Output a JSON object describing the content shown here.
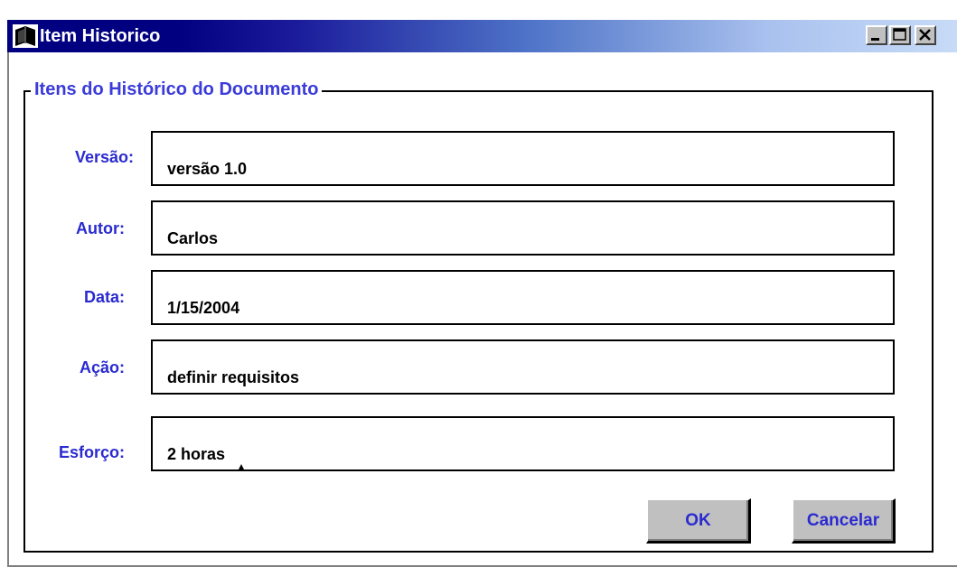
{
  "window": {
    "title": "Item Historico",
    "icon": "book-icon"
  },
  "titlebar_buttons": {
    "minimize": "minimize-icon",
    "maximize": "maximize-icon",
    "close": "close-icon"
  },
  "group": {
    "title": "Itens do Histórico do Documento"
  },
  "fields": [
    {
      "label": "Versão:",
      "value": "versão 1.0"
    },
    {
      "label": "Autor:",
      "value": "Carlos"
    },
    {
      "label": "Data:",
      "value": "1/15/2004"
    },
    {
      "label": "Ação:",
      "value": "definir requisitos"
    },
    {
      "label": "Esforço:",
      "value": "2 horas"
    }
  ],
  "buttons": {
    "ok": "OK",
    "cancel": "Cancelar"
  },
  "colors": {
    "title_bar": "#000080",
    "label_blue": "#2a2ad0",
    "button_face": "#c0c0c0"
  }
}
